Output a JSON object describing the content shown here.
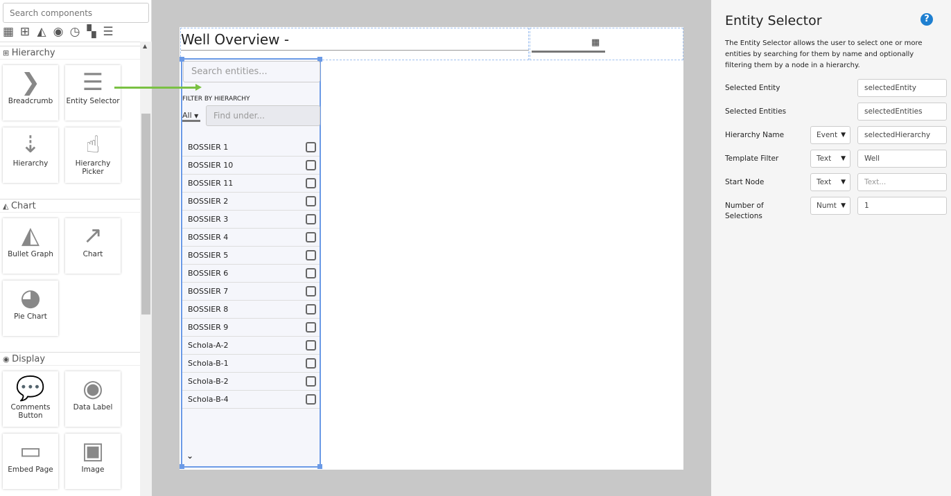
{
  "palette": {
    "search_placeholder": "Search components",
    "categories": [
      "table-icon",
      "hierarchy-icon",
      "chart-icon",
      "eye-icon",
      "clock-icon",
      "grid-icon",
      "sliders-icon"
    ],
    "sections": [
      {
        "label": "Hierarchy",
        "icon": "hierarchy-icon",
        "items": [
          {
            "label": "Breadcrumb",
            "icon": "chevron-right-icon"
          },
          {
            "label": "Entity Selector",
            "icon": "list-icon"
          },
          {
            "label": "Hierarchy",
            "icon": "sort-list-icon"
          },
          {
            "label": "Hierarchy Picker",
            "icon": "hand-pointer-icon"
          }
        ]
      },
      {
        "label": "Chart",
        "icon": "chart-icon",
        "items": [
          {
            "label": "Bullet Graph",
            "icon": "area-chart-icon"
          },
          {
            "label": "Chart",
            "icon": "line-chart-icon"
          },
          {
            "label": "Pie Chart",
            "icon": "pie-chart-icon"
          }
        ]
      },
      {
        "label": "Display",
        "icon": "eye-icon",
        "items": [
          {
            "label": "Comments Button",
            "icon": "comments-icon"
          },
          {
            "label": "Data Label",
            "icon": "eye-icon"
          },
          {
            "label": "Embed Page",
            "icon": "monitor-icon"
          },
          {
            "label": "Image",
            "icon": "image-icon"
          }
        ]
      }
    ]
  },
  "canvas": {
    "title": "Well Overview -",
    "entity_selector": {
      "search_placeholder": "Search entities...",
      "filter_label": "FILTER BY HIERARCHY",
      "filter_value": "All",
      "find_placeholder": "Find under...",
      "entities": [
        "BOSSIER 1",
        "BOSSIER 10",
        "BOSSIER 11",
        "BOSSIER 2",
        "BOSSIER 3",
        "BOSSIER 4",
        "BOSSIER 5",
        "BOSSIER 6",
        "BOSSIER 7",
        "BOSSIER 8",
        "BOSSIER 9",
        "Schola-A-2",
        "Schola-B-1",
        "Schola-B-2",
        "Schola-B-4"
      ]
    }
  },
  "properties": {
    "title": "Entity Selector",
    "help": "?",
    "description": "The Entity Selector allows the user to select one or more entities by searching for them by name and optionally filtering them by a node in a hierarchy.",
    "fields": [
      {
        "label": "Selected Entity",
        "type": null,
        "value": "selectedEntity",
        "link": "↕"
      },
      {
        "label": "Selected Entities",
        "type": null,
        "value": "selectedEntities",
        "link": "↕"
      },
      {
        "label": "Hierarchy Name",
        "type": "Event",
        "value": "selectedHierarchy",
        "link": "↓"
      },
      {
        "label": "Template Filter",
        "type": "Text",
        "value": "Well",
        "link": null
      },
      {
        "label": "Start Node",
        "type": "Text",
        "placeholder": "Text...",
        "link": null
      },
      {
        "label": "Number of Selections",
        "type": "Numt",
        "value": "1",
        "link": null
      }
    ]
  },
  "colors": {
    "accent": "#6b9ae6",
    "arrow": "#7ac143",
    "help": "#1e7fd0"
  }
}
